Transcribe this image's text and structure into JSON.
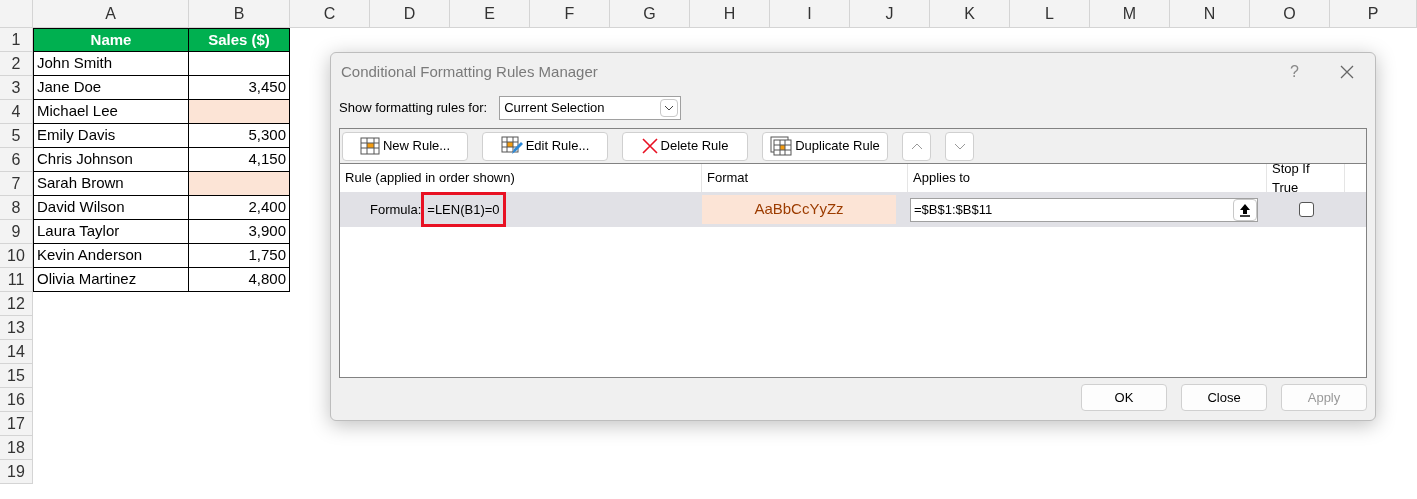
{
  "sheet": {
    "columns": [
      "A",
      "B",
      "C",
      "D",
      "E",
      "F",
      "G",
      "H",
      "I",
      "J",
      "K",
      "L",
      "M",
      "N",
      "O",
      "P"
    ],
    "header": {
      "number": "1",
      "name": "Name",
      "sales": "Sales ($)"
    },
    "rows": [
      {
        "number": "2",
        "name": "John Smith",
        "sales": "",
        "highlighted": false
      },
      {
        "number": "3",
        "name": "Jane Doe",
        "sales": "3,450",
        "highlighted": false
      },
      {
        "number": "4",
        "name": "Michael Lee",
        "sales": "",
        "highlighted": true
      },
      {
        "number": "5",
        "name": "Emily Davis",
        "sales": "5,300",
        "highlighted": false
      },
      {
        "number": "6",
        "name": "Chris Johnson",
        "sales": "4,150",
        "highlighted": false
      },
      {
        "number": "7",
        "name": "Sarah Brown",
        "sales": "",
        "highlighted": true
      },
      {
        "number": "8",
        "name": "David Wilson",
        "sales": "2,400",
        "highlighted": false
      },
      {
        "number": "9",
        "name": "Laura Taylor",
        "sales": "3,900",
        "highlighted": false
      },
      {
        "number": "10",
        "name": "Kevin Anderson",
        "sales": "1,750",
        "highlighted": false
      },
      {
        "number": "11",
        "name": "Olivia Martinez",
        "sales": "4,800",
        "highlighted": false
      }
    ],
    "empty_rows": [
      "12",
      "13",
      "14",
      "15",
      "16",
      "17",
      "18",
      "19"
    ]
  },
  "dialog": {
    "title": "Conditional Formatting Rules Manager",
    "help": "?",
    "show_label": "Show formatting rules for:",
    "show_value": "Current Selection",
    "toolbar": [
      {
        "kind": "new",
        "label": "New Rule..."
      },
      {
        "kind": "edit",
        "label": "Edit Rule..."
      },
      {
        "kind": "delete",
        "label": "Delete Rule"
      },
      {
        "kind": "duplicate",
        "label": "Duplicate Rule"
      },
      {
        "kind": "up"
      },
      {
        "kind": "down"
      }
    ],
    "columns": [
      "Rule (applied in order shown)",
      "Format",
      "Applies to",
      "Stop If True"
    ],
    "rules": [
      {
        "label": "Formula:",
        "formula": "=LEN(B1)=0",
        "annotation_box": true,
        "format_preview": "AaBbCcYyZz",
        "applies_to": "=$B$1:$B$11",
        "stop_if_true": false,
        "selected": true
      }
    ],
    "buttons": [
      {
        "label": "OK",
        "disabled": false
      },
      {
        "label": "Close",
        "disabled": false
      },
      {
        "label": "Apply",
        "disabled": true
      }
    ]
  }
}
